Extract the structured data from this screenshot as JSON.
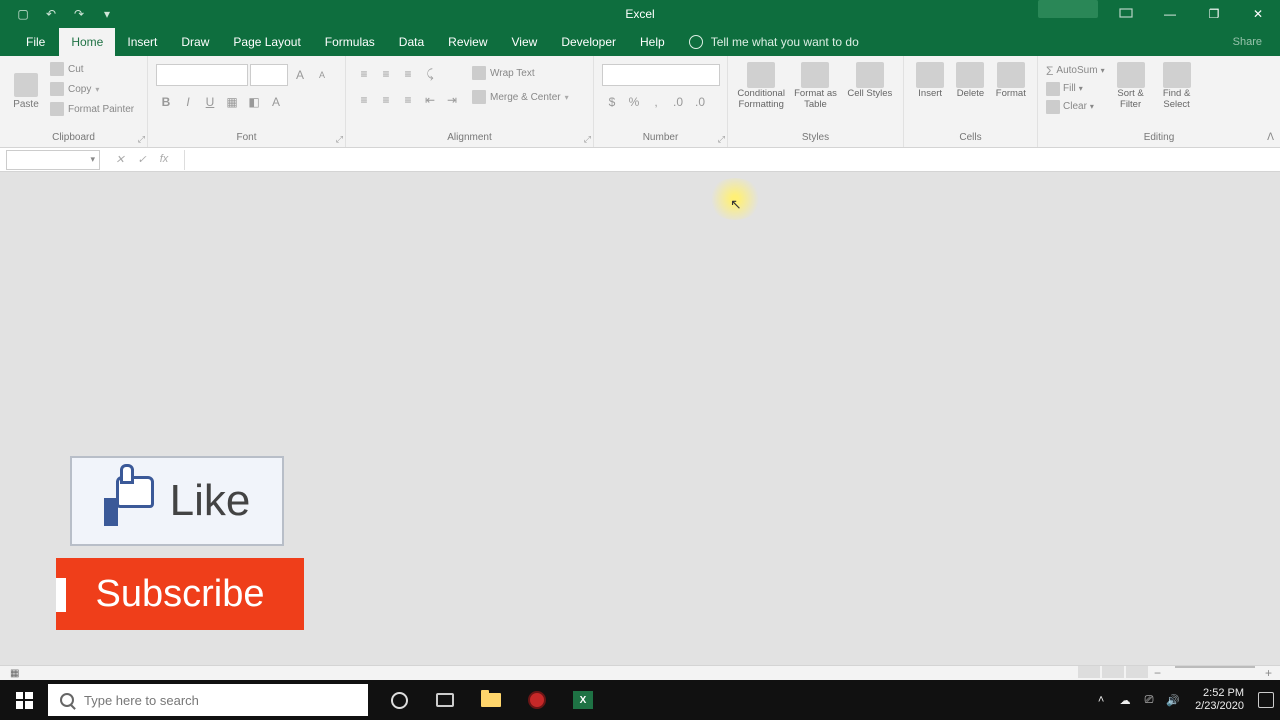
{
  "titlebar": {
    "app_title": "Excel"
  },
  "menu": {
    "file": "File",
    "home": "Home",
    "insert": "Insert",
    "draw": "Draw",
    "page_layout": "Page Layout",
    "formulas": "Formulas",
    "data": "Data",
    "review": "Review",
    "view": "View",
    "developer": "Developer",
    "help": "Help",
    "tell_me": "Tell me what you want to do",
    "share": "Share"
  },
  "ribbon": {
    "clipboard": {
      "label": "Clipboard",
      "paste": "Paste",
      "cut": "Cut",
      "copy": "Copy",
      "format_painter": "Format Painter"
    },
    "font": {
      "label": "Font"
    },
    "alignment": {
      "label": "Alignment",
      "wrap_text": "Wrap Text",
      "merge_center": "Merge & Center"
    },
    "number": {
      "label": "Number"
    },
    "styles": {
      "label": "Styles",
      "conditional": "Conditional Formatting",
      "format_table": "Format as Table",
      "cell_styles": "Cell Styles"
    },
    "cells": {
      "label": "Cells",
      "insert": "Insert",
      "delete": "Delete",
      "format": "Format"
    },
    "editing": {
      "label": "Editing",
      "autosum": "AutoSum",
      "fill": "Fill",
      "clear": "Clear",
      "sort_filter": "Sort & Filter",
      "find_select": "Find & Select"
    }
  },
  "overlay": {
    "like": "Like",
    "subscribe": "Subscribe"
  },
  "taskbar": {
    "search_placeholder": "Type here to search",
    "time": "2:52 PM",
    "date": "2/23/2020"
  }
}
